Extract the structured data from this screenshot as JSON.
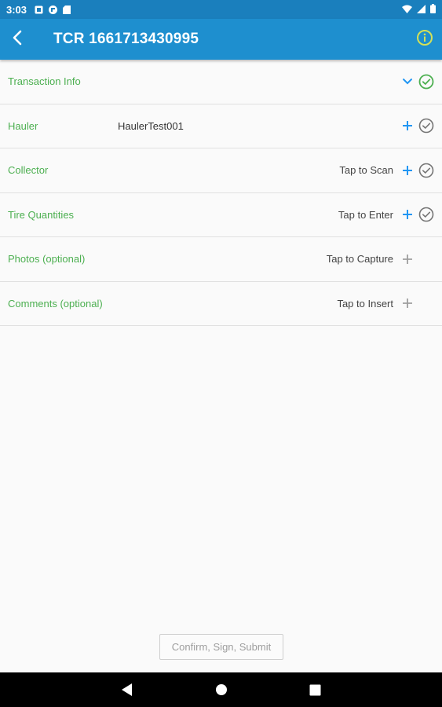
{
  "status_bar": {
    "time": "3:03",
    "left_icons": [
      "notification-square-icon",
      "flipboard-icon",
      "sd-card-icon"
    ],
    "right_icons": [
      "wifi-icon",
      "signal-icon",
      "battery-icon"
    ]
  },
  "app_bar": {
    "title": "TCR 1661713430995",
    "back_icon": "arrow-back-icon",
    "info_icon": "info-icon",
    "info_color": "#d4e157"
  },
  "rows": [
    {
      "label": "Transaction Info",
      "value": "",
      "hint": "",
      "action_icon": "chevron-down-icon",
      "status": "complete"
    },
    {
      "label": "Hauler",
      "value": "HaulerTest001",
      "hint": "",
      "action_icon": "plus-icon",
      "status": "pending"
    },
    {
      "label": "Collector",
      "value": "",
      "hint": "Tap to Scan",
      "action_icon": "plus-icon",
      "status": "pending"
    },
    {
      "label": "Tire Quantities",
      "value": "",
      "hint": "Tap to Enter",
      "action_icon": "plus-icon",
      "status": "pending"
    },
    {
      "label": "Photos (optional)",
      "value": "",
      "hint": "Tap to Capture",
      "action_icon": "plus-icon-gray",
      "status": "none"
    },
    {
      "label": "Comments (optional)",
      "value": "",
      "hint": "Tap to Insert",
      "action_icon": "plus-icon-gray",
      "status": "none"
    }
  ],
  "submit_button": {
    "label": "Confirm, Sign, Submit",
    "enabled": false
  },
  "colors": {
    "app_bar": "#1e8fcf",
    "status_bar": "#1a7fbd",
    "label_green": "#4caf50",
    "accent_blue": "#2196f3",
    "check_complete": "#4caf50",
    "check_pending": "#757575"
  },
  "nav_bar": {
    "icons": [
      "back-triangle-icon",
      "home-circle-icon",
      "recents-square-icon"
    ]
  }
}
